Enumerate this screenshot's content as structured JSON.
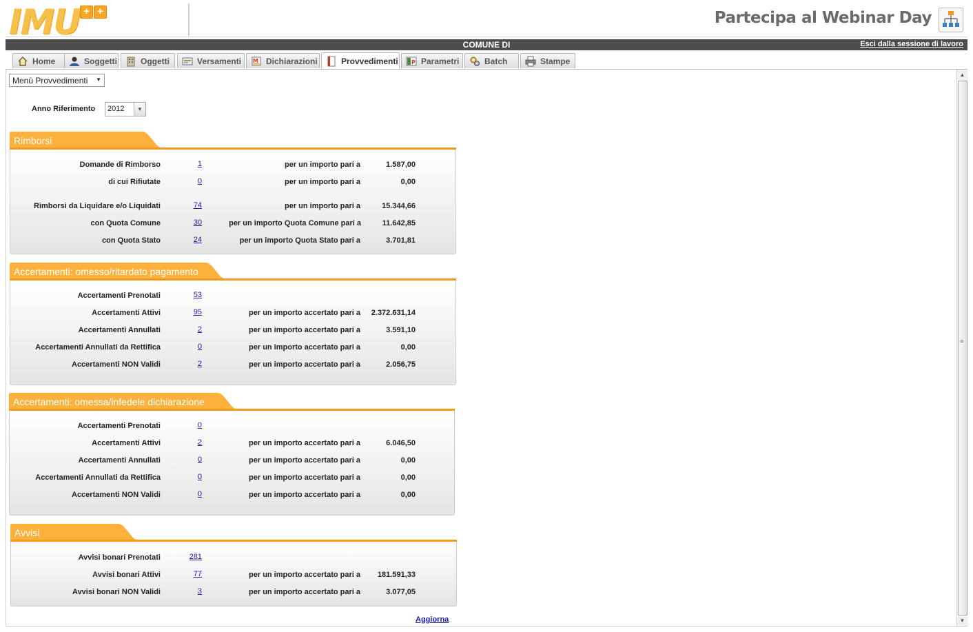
{
  "header": {
    "logo_text": "IMU",
    "logo_plus": [
      "+",
      "+"
    ],
    "webinar_text": "Partecipa al Webinar Day",
    "comune_label": "COMUNE DI",
    "logout_link": "Esci dalla sessione di lavoro"
  },
  "tabs": [
    {
      "label": "Home",
      "icon": "home-icon",
      "active": false
    },
    {
      "label": "Soggetti",
      "icon": "user-icon",
      "active": false
    },
    {
      "label": "Oggetti",
      "icon": "building-icon",
      "active": false
    },
    {
      "label": "Versamenti",
      "icon": "payment-icon",
      "active": false
    },
    {
      "label": "Dichiarazioni",
      "icon": "declaration-icon",
      "active": false
    },
    {
      "label": "Provvedimenti",
      "icon": "document-icon",
      "active": true
    },
    {
      "label": "Parametri",
      "icon": "parameters-icon",
      "active": false
    },
    {
      "label": "Batch",
      "icon": "gears-icon",
      "active": false
    },
    {
      "label": "Stampe",
      "icon": "printer-icon",
      "active": false
    }
  ],
  "menu": {
    "selected": "Menù Provvedimenti"
  },
  "anno": {
    "label": "Anno Riferimento",
    "value": "2012"
  },
  "colors": {
    "accent": "#fbb13c",
    "accent_dark": "#f39a1c",
    "link": "#1a1aa6",
    "topbar": "#4d4d4d"
  },
  "sections": [
    {
      "title": "Rimborsi",
      "rows": [
        {
          "label": "Domande di Rimborso",
          "count": "1",
          "text": "per un importo pari a",
          "amount": "1.587,00"
        },
        {
          "label": "di cui Rifiutate",
          "count": "0",
          "text": "per un importo pari a",
          "amount": "0,00"
        },
        {
          "label": "Rimborsi da Liquidare e/o Liquidati",
          "count": "74",
          "text": "per un importo pari a",
          "amount": "15.344,66"
        },
        {
          "label": "con Quota Comune",
          "count": "30",
          "text": "per un importo Quota Comune pari a",
          "amount": "11.642,85"
        },
        {
          "label": "con Quota Stato",
          "count": "24",
          "text": "per un importo Quota Stato pari a",
          "amount": "3.701,81"
        }
      ]
    },
    {
      "title": "Accertamenti: omesso/ritardato pagamento",
      "rows": [
        {
          "label": "Accertamenti Prenotati",
          "count": "53",
          "text": "",
          "amount": ""
        },
        {
          "label": "Accertamenti Attivi",
          "count": "95",
          "text": "per un importo accertato pari a",
          "amount": "2.372.631,14"
        },
        {
          "label": "Accertamenti Annullati",
          "count": "2",
          "text": "per un importo accertato pari a",
          "amount": "3.591,10"
        },
        {
          "label": "Accertamenti Annullati da Rettifica",
          "count": "0",
          "text": "per un importo accertato pari a",
          "amount": "0,00"
        },
        {
          "label": "Accertamenti NON Validi",
          "count": "2",
          "text": "per un importo accertato pari a",
          "amount": "2.056,75"
        }
      ]
    },
    {
      "title": "Accertamenti: omessa/infedele dichiarazione",
      "rows": [
        {
          "label": "Accertamenti Prenotati",
          "count": "0",
          "text": "",
          "amount": ""
        },
        {
          "label": "Accertamenti Attivi",
          "count": "2",
          "text": "per un importo accertato pari a",
          "amount": "6.046,50"
        },
        {
          "label": "Accertamenti Annullati",
          "count": "0",
          "text": "per un importo accertato pari a",
          "amount": "0,00"
        },
        {
          "label": "Accertamenti Annullati da Rettifica",
          "count": "0",
          "text": "per un importo accertato pari a",
          "amount": "0,00"
        },
        {
          "label": "Accertamenti NON Validi",
          "count": "0",
          "text": "per un importo accertato pari a",
          "amount": "0,00"
        }
      ]
    },
    {
      "title": "Avvisi",
      "rows": [
        {
          "label": "Avvisi bonari Prenotati",
          "count": "281",
          "text": "",
          "amount": ""
        },
        {
          "label": "Avvisi bonari Attivi",
          "count": "77",
          "text": "per un importo accertato pari a",
          "amount": "181.591,33"
        },
        {
          "label": "Avvisi bonari NON Validi",
          "count": "3",
          "text": "per un importo accertato pari a",
          "amount": "3.077,05"
        }
      ]
    }
  ],
  "refresh_link": "Aggiorna"
}
